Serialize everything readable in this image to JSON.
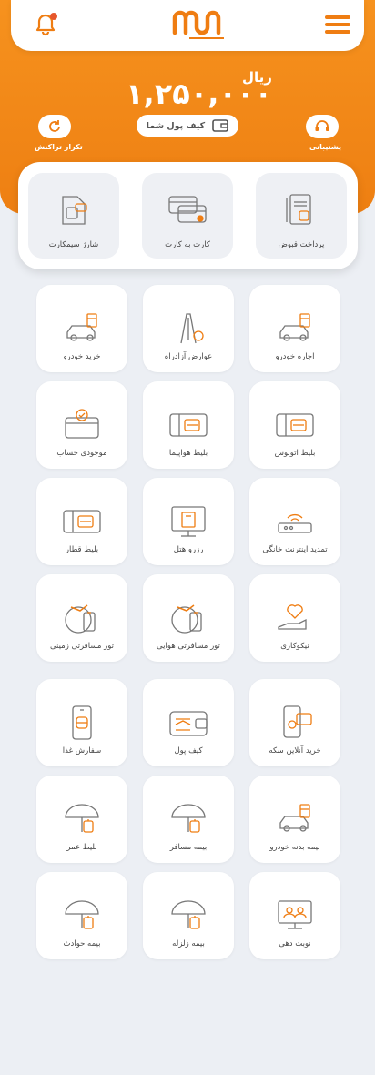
{
  "header": {
    "notification_icon": "bell-icon",
    "menu_icon": "hamburger-icon",
    "brand_color": "#ef7d12"
  },
  "balance": {
    "amount": "۱,۲۵۰,۰۰۰",
    "unit": "ریال"
  },
  "actions": {
    "support_label": "پشتیبانی",
    "wallet_label": "کیف پول شما",
    "repeat_label": "تکرار تراکنش"
  },
  "quick": [
    {
      "label": "پرداخت قبوض",
      "icon": "bill-icon"
    },
    {
      "label": "کارت به کارت",
      "icon": "card-transfer-icon"
    },
    {
      "label": "شارژ سیمکارت",
      "icon": "simcard-icon"
    }
  ],
  "services": [
    {
      "label": "اجاره خودرو",
      "icon": "car-rent-icon"
    },
    {
      "label": "عوارض آزادراه",
      "icon": "highway-toll-icon"
    },
    {
      "label": "خرید خودرو",
      "icon": "car-buy-icon"
    },
    {
      "label": "بلیط اتوبوس",
      "icon": "bus-ticket-icon"
    },
    {
      "label": "بلیط هواپیما",
      "icon": "plane-ticket-icon"
    },
    {
      "label": "موجودی حساب",
      "icon": "balance-card-icon"
    },
    {
      "label": "تمدید اینترنت خانگی",
      "icon": "router-icon"
    },
    {
      "label": "رزرو هتل",
      "icon": "hotel-icon"
    },
    {
      "label": "بلیط قطار",
      "icon": "train-ticket-icon"
    },
    {
      "label": "نیکوکاری",
      "icon": "charity-icon"
    },
    {
      "label": "تور مسافرتی هوایی",
      "icon": "air-tour-icon"
    },
    {
      "label": "تور مسافرتی زمینی",
      "icon": "land-tour-icon"
    },
    {
      "label": "خرید آنلاین سکه",
      "icon": "coin-icon"
    },
    {
      "label": "کیف پول",
      "icon": "wallet-icon"
    },
    {
      "label": "سفارش غذا",
      "icon": "food-order-icon"
    },
    {
      "label": "بیمه بدنه خودرو",
      "icon": "car-insurance-icon"
    },
    {
      "label": "بیمه مسافر",
      "icon": "travel-insurance-icon"
    },
    {
      "label": "بلیط عمر",
      "icon": "life-insurance-icon"
    },
    {
      "label": "نوبت دهی",
      "icon": "appointment-icon"
    },
    {
      "label": "بیمه زلزله",
      "icon": "earthquake-insurance-icon"
    },
    {
      "label": "بیمه حوادث",
      "icon": "accident-insurance-icon"
    }
  ]
}
